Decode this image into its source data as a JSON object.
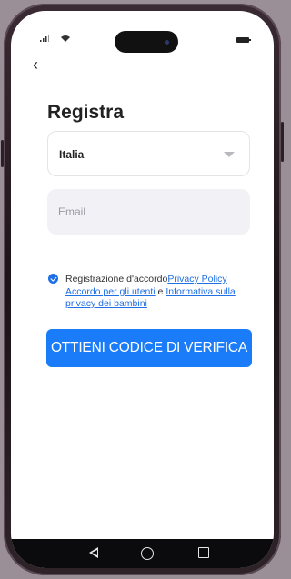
{
  "status_bar": {
    "signal_icon": "signal-icon",
    "wifi_icon": "wifi-icon",
    "battery_icon": "battery-icon"
  },
  "header": {
    "back_icon": "back-arrow-icon",
    "back_glyph": "‹",
    "title": "Registra"
  },
  "form": {
    "country": {
      "value": "Italia",
      "icon": "chevron-down-icon"
    },
    "email": {
      "placeholder": "Email",
      "value": ""
    },
    "agreement": {
      "checked": true,
      "prefix": "Registrazione d'accordo",
      "link_privacy_policy": "Privacy Policy",
      "link_user_agreement": "Accordo per gli utenti",
      "conjunction": " e ",
      "link_children_privacy": "Informativa sulla privacy dei bambini"
    },
    "submit_label": "OTTIENI CODICE DI VERIFICA"
  },
  "nav_bar": {
    "back_icon": "nav-back-icon",
    "home_icon": "nav-home-icon",
    "recents_icon": "nav-recents-icon"
  },
  "colors": {
    "accent": "#1a7cf8",
    "link": "#1f6fe5",
    "phone_frame": "#2a1f25",
    "background": "#9a8f96"
  }
}
